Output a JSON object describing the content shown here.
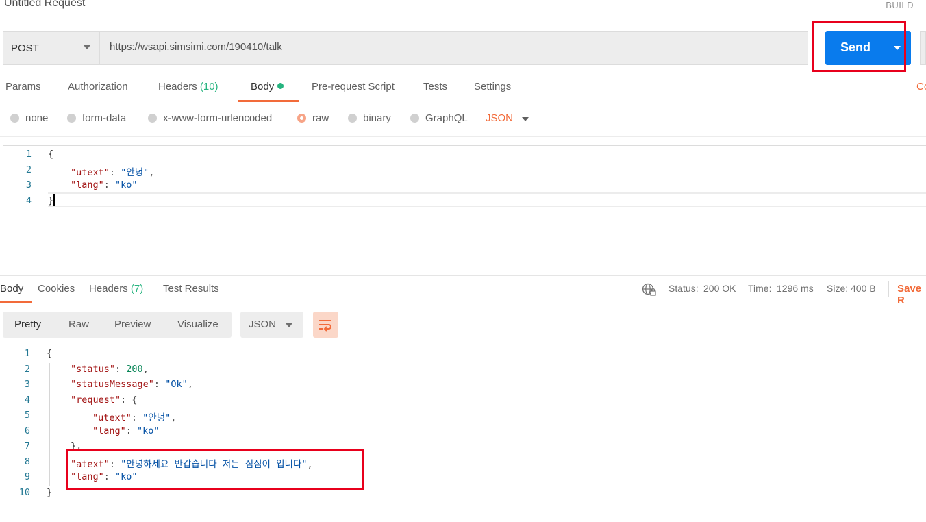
{
  "window": {
    "title": "Untitled Request",
    "build_label": "BUILD"
  },
  "request": {
    "method": "POST",
    "url": "https://wsapi.simsimi.com/190410/talk",
    "send_label": "Send"
  },
  "request_tabs": {
    "params": "Params",
    "authorization": "Authorization",
    "headers": "Headers",
    "headers_count": "(10)",
    "body": "Body",
    "prerequest": "Pre-request Script",
    "tests": "Tests",
    "settings": "Settings",
    "cookies_partial": "Co"
  },
  "body_modes": {
    "none": "none",
    "form_data": "form-data",
    "urlencoded": "x-www-form-urlencoded",
    "raw": "raw",
    "binary": "binary",
    "graphql": "GraphQL",
    "format": "JSON",
    "selected": "raw"
  },
  "request_body": {
    "line_numbers": [
      "1",
      "2",
      "3",
      "4"
    ],
    "open": "{",
    "k1": "\"utext\"",
    "v1": "\"안녕\"",
    "k2": "\"lang\"",
    "v2": "\"ko\"",
    "close": "}"
  },
  "response_tabs": {
    "body": "Body",
    "cookies": "Cookies",
    "headers": "Headers",
    "headers_count": "(7)",
    "test_results": "Test Results"
  },
  "response_status": {
    "status_label": "Status:",
    "status_value": "200 OK",
    "time_label": "Time:",
    "time_value": "1296 ms",
    "size_label": "Size:",
    "size_value": "400 B",
    "save_partial": "Save R"
  },
  "response_view": {
    "pretty": "Pretty",
    "raw": "Raw",
    "preview": "Preview",
    "visualize": "Visualize",
    "format": "JSON"
  },
  "response_body": {
    "line_numbers": [
      "1",
      "2",
      "3",
      "4",
      "5",
      "6",
      "7",
      "8",
      "9",
      "10"
    ],
    "open": "{",
    "status_key": "\"status\"",
    "status_val": "200",
    "msg_key": "\"statusMessage\"",
    "msg_val": "\"Ok\"",
    "req_key": "\"request\"",
    "utext_key": "\"utext\"",
    "utext_val": "\"안녕\"",
    "lang_key": "\"lang\"",
    "lang_val": "\"ko\"",
    "inner_close": "},",
    "atext_key": "\"atext\"",
    "atext_val": "\"안녕하세요 반갑습니다 저는 심심이 입니다\"",
    "lang2_key": "\"lang\"",
    "lang2_val": "\"ko\"",
    "close": "}"
  },
  "colors": {
    "accent": "#f26b3a",
    "send_blue": "#097bed",
    "status_green": "#26b47f",
    "highlight_red": "#e8001c"
  }
}
